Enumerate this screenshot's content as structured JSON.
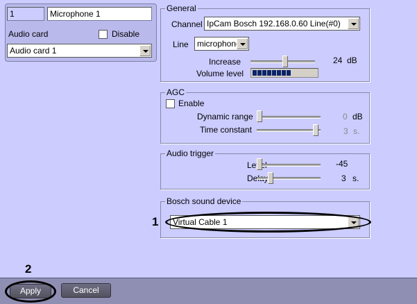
{
  "camera": {
    "id": "1",
    "name": "Microphone 1",
    "audio_card_label": "Audio card",
    "disable_label": "Disable",
    "disable_checked": false,
    "audio_card_value": "Audio card 1"
  },
  "general": {
    "title": "General",
    "channel_label": "Channel",
    "channel_value": "IpCam Bosch 192.168.0.60 Line(#0)",
    "line_label": "Line",
    "line_value": "microphone",
    "increase_label": "Increase",
    "increase_value": "24",
    "increase_unit": "dB",
    "increase_fraction": 0.55,
    "volume_label": "Volume level",
    "volume_blocks": 8
  },
  "agc": {
    "title": "AGC",
    "enable_label": "Enable",
    "enable_checked": false,
    "dynamic_label": "Dynamic range",
    "dynamic_value": "0",
    "dynamic_unit": "dB",
    "time_label": "Time constant",
    "time_value": "3",
    "time_unit": "s."
  },
  "trigger": {
    "title": "Audio trigger",
    "level_label": "Level",
    "level_value": "-45",
    "delay_label": "Delay",
    "delay_value": "3",
    "delay_unit": "s."
  },
  "bosch": {
    "title": "Bosch sound device",
    "device_value": "Virtual Cable 1"
  },
  "annotations": {
    "one": "1",
    "two": "2"
  },
  "buttons": {
    "apply": "Apply",
    "cancel": "Cancel"
  }
}
